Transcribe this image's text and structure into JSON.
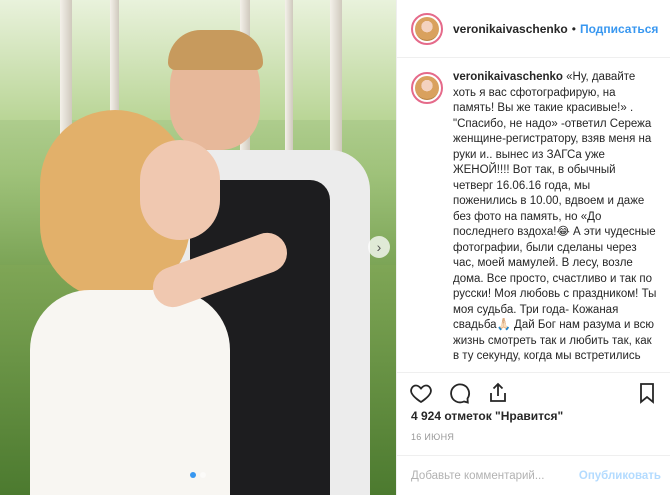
{
  "post": {
    "username": "veronikaivaschenko",
    "follow_label": "Подписаться",
    "separator": "•",
    "caption_username": "veronikaivaschenko",
    "caption_text": " «Ну, давайте хоть я вас сфотографирую, на память! Вы же такие красивые!» . \"Спасибо, не надо» -ответил Сережа женщине-регистратору, взяв меня на руки и.. вынес из ЗАГСа уже ЖЕНОЙ!!!! Вот так, в обычный четверг 16.06.16 года, мы поженились в 10.00, вдвоем и даже без фото на память, но «До последнего вздоха!😂 А эти чудесные фотографии, были сделаны через час, моей мамулей. В лесу, возле дома. Все просто, счастливо и так по русски! Моя любовь с праздником! Ты моя судьба. Три года- Кожаная свадьба🙏🏻 Дай Бог нам разума и всю жизнь смотреть так и любить так, как в ту секунду, когда мы встретились",
    "likes": "4 924 отметок \"Нравится\"",
    "date": "16 ИЮНЯ",
    "comment_placeholder": "Добавьте комментарий...",
    "publish_label": "Опубликовать"
  },
  "photo": {
    "next_arrow": "›"
  },
  "icons": {
    "like": "heart-icon",
    "comment": "comment-icon",
    "share": "share-icon",
    "save": "bookmark-icon"
  },
  "colors": {
    "accent": "#3897f0",
    "publish_disabled": "#b3dbff",
    "story_ring": "#e56a8a"
  }
}
